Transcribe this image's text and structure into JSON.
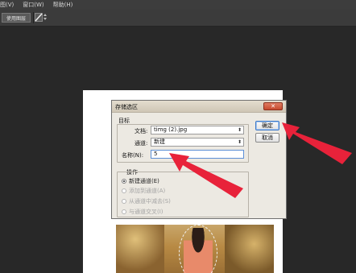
{
  "menubar": {
    "items": [
      "图(V)",
      "窗口(W)",
      "帮助(H)"
    ]
  },
  "options_bar": {
    "use_image_button": "使用图层"
  },
  "dialog": {
    "title": "存储选区",
    "close_symbol": "✕",
    "target_group": "目标",
    "document_label": "文档:",
    "document_value": "timg (2).jpg",
    "channel_label": "通道:",
    "channel_value": "新建",
    "name_label": "名称(N):",
    "name_value": "5",
    "operation_group": "操作",
    "operations": [
      {
        "label": "新建通道(E)",
        "checked": true,
        "enabled": true
      },
      {
        "label": "添加到通道(A)",
        "checked": false,
        "enabled": false
      },
      {
        "label": "从通道中减去(S)",
        "checked": false,
        "enabled": false
      },
      {
        "label": "与通道交叉(I)",
        "checked": false,
        "enabled": false
      }
    ],
    "ok_button": "确定",
    "cancel_button": "取消"
  },
  "colors": {
    "annotation_arrow": "#e8223a",
    "workspace_bg": "#282828",
    "dialog_bg": "#ece9e2"
  }
}
